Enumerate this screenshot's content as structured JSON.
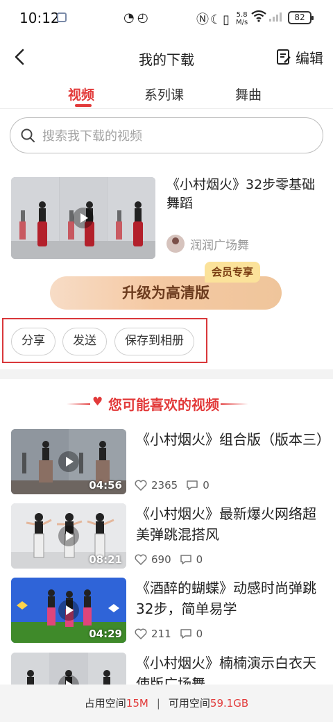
{
  "status_bar": {
    "time": "10:12",
    "net_speed_value": "5.8",
    "net_speed_unit": "M/s",
    "battery": "82"
  },
  "header": {
    "title": "我的下载",
    "edit_label": "编辑"
  },
  "tabs": [
    {
      "label": "视频",
      "active": true
    },
    {
      "label": "系列课",
      "active": false
    },
    {
      "label": "舞曲",
      "active": false
    }
  ],
  "search": {
    "placeholder": "搜索我下载的视频"
  },
  "download_item": {
    "title": "《小村烟火》32步零基础舞蹈",
    "author": "润润广场舞",
    "vip_badge": "会员专享",
    "upgrade_label": "升级为高清版",
    "actions": [
      "分享",
      "发送",
      "保存到相册"
    ]
  },
  "recommend": {
    "heading": "您可能喜欢的视频",
    "items": [
      {
        "title": "《小村烟火》组合版（版本三）",
        "duration": "04:56",
        "likes": "2365",
        "comments": "0"
      },
      {
        "title": "《小村烟火》最新爆火网络超美弹跳混搭风",
        "duration": "08:21",
        "likes": "690",
        "comments": "0"
      },
      {
        "title": "《酒醉的蝴蝶》动感时尚弹跳32步，简单易学",
        "duration": "04:29",
        "likes": "211",
        "comments": "0"
      },
      {
        "title": "《小村烟火》楠楠演示白衣天使版广场舞",
        "duration": "",
        "likes": "",
        "comments": ""
      }
    ]
  },
  "footer": {
    "used_label": "占用空间",
    "used_value": "15M",
    "separator": "|",
    "free_label": "可用空间",
    "free_value": "59.1GB"
  },
  "colors": {
    "accent": "#e23a3a",
    "upgrade_text": "#6b3a1d",
    "vip_badge_bg": "#fbe29a"
  }
}
